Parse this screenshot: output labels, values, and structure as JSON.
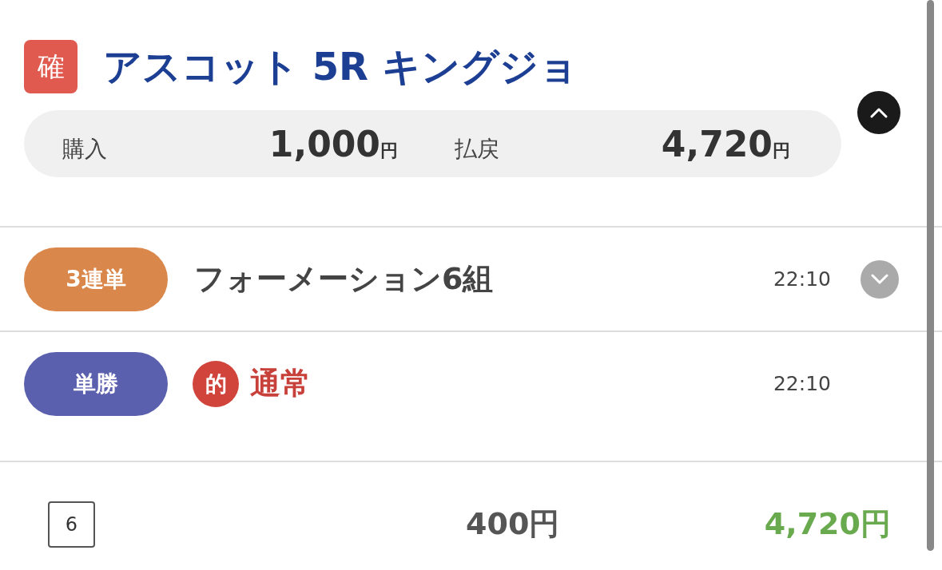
{
  "race": {
    "status_badge": "確",
    "title": "アスコット 5R キングジョ",
    "expanded": true
  },
  "summary": [
    {
      "label": "購入",
      "amount": "1,000",
      "unit": "円"
    },
    {
      "label": "払戻",
      "amount": "4,720",
      "unit": "円"
    }
  ],
  "bets": [
    {
      "type": "3連単",
      "color": "#d9874a",
      "description": "フォーメーション6組",
      "time": "22:10",
      "hit": false,
      "expanded": false
    },
    {
      "type": "単勝",
      "color": "#5a5fae",
      "hit_mark": "的",
      "description": "通常",
      "time": "22:10",
      "hit": true
    }
  ],
  "detail": {
    "horse": "6",
    "stake": "400円",
    "payout": "4,720円"
  }
}
